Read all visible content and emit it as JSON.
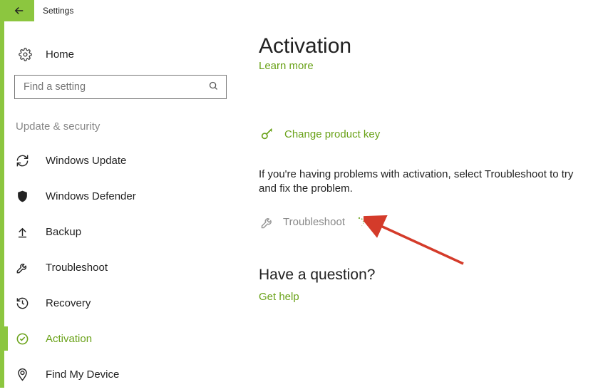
{
  "app": {
    "title": "Settings"
  },
  "sidebar": {
    "home_label": "Home",
    "search_placeholder": "Find a setting",
    "section_header": "Update & security",
    "items": [
      {
        "label": "Windows Update"
      },
      {
        "label": "Windows Defender"
      },
      {
        "label": "Backup"
      },
      {
        "label": "Troubleshoot"
      },
      {
        "label": "Recovery"
      },
      {
        "label": "Activation"
      },
      {
        "label": "Find My Device"
      }
    ]
  },
  "main": {
    "title": "Activation",
    "learn_more": "Learn more",
    "change_key": "Change product key",
    "body_text": "If you're having problems with activation, select Troubleshoot to try and fix the problem.",
    "troubleshoot_label": "Troubleshoot",
    "question_heading": "Have a question?",
    "get_help": "Get help"
  },
  "colors": {
    "accent": "#8cc63f",
    "link": "#6aa219"
  }
}
